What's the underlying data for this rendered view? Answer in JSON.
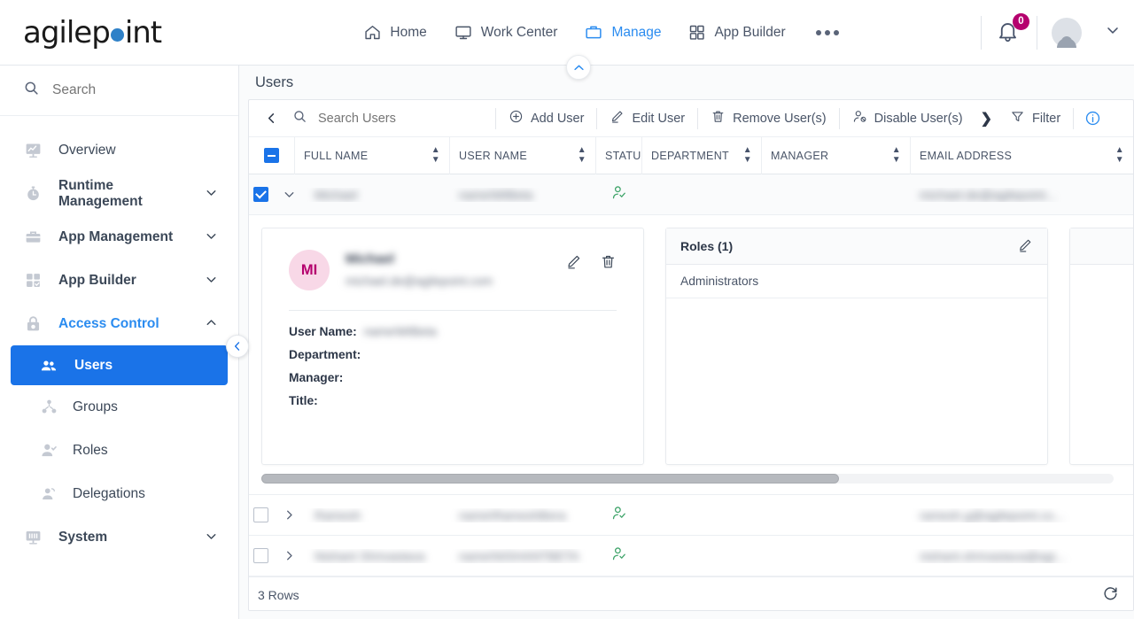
{
  "brand": {
    "name": "agilepoint",
    "accent": "#2f81c8"
  },
  "topnav": {
    "items": [
      {
        "label": "Home",
        "icon": "home-icon",
        "active": false
      },
      {
        "label": "Work Center",
        "icon": "monitor-icon",
        "active": false
      },
      {
        "label": "Manage",
        "icon": "briefcase-icon",
        "active": true
      },
      {
        "label": "App Builder",
        "icon": "grid-icon",
        "active": false
      }
    ],
    "more_label": "...",
    "notification_count": "0",
    "notification_badge_color": "#b5006e",
    "user_name": "",
    "active_color": "#2b8cf0"
  },
  "sidebar": {
    "search_placeholder": "Search",
    "search_value": "",
    "items": [
      {
        "label": "Overview",
        "icon": "chart-monitor-icon",
        "state": "plain"
      },
      {
        "label": "Runtime Management",
        "icon": "clock-icon",
        "state": "collapsed",
        "bold": true
      },
      {
        "label": "App Management",
        "icon": "toolbox-icon",
        "state": "collapsed",
        "bold": true
      },
      {
        "label": "App Builder",
        "icon": "grid-check-icon",
        "state": "collapsed",
        "bold": true
      },
      {
        "label": "Access Control",
        "icon": "lock-icon",
        "state": "expanded",
        "bold": true
      },
      {
        "label": "Users",
        "icon": "users-icon",
        "state": "selected",
        "sub": true
      },
      {
        "label": "Groups",
        "icon": "group-icon",
        "state": "plain",
        "sub": true
      },
      {
        "label": "Roles",
        "icon": "role-user-icon",
        "state": "plain",
        "sub": true
      },
      {
        "label": "Delegations",
        "icon": "delegation-user-icon",
        "state": "plain",
        "sub": true
      },
      {
        "label": "System",
        "icon": "system-monitor-icon",
        "state": "collapsed",
        "bold": true
      }
    ],
    "selected_color": "#1a73e8"
  },
  "page": {
    "title": "Users"
  },
  "toolbar": {
    "search_placeholder": "Search Users",
    "search_value": "",
    "buttons": [
      {
        "label": "Add User",
        "icon": "plus-circle-icon"
      },
      {
        "label": "Edit User",
        "icon": "pencil-icon"
      },
      {
        "label": "Remove User(s)",
        "icon": "trash-icon"
      },
      {
        "label": "Disable User(s)",
        "icon": "user-disable-icon"
      }
    ],
    "overflow_label": "❯",
    "filter_label": "Filter",
    "info_icon": "info-circle-icon"
  },
  "table": {
    "columns": [
      {
        "label": "FULL NAME",
        "sortable": true
      },
      {
        "label": "USER NAME",
        "sortable": true
      },
      {
        "label": "STATUS",
        "sortable": false
      },
      {
        "label": "DEPARTMENT",
        "sortable": true
      },
      {
        "label": "MANAGER",
        "sortable": true
      },
      {
        "label": "EMAIL ADDRESS",
        "sortable": true
      }
    ],
    "header_checkbox_state": "indeterminate",
    "rows": [
      {
        "checked": true,
        "expanded": true,
        "full_name": "Michael",
        "user_name": "name\\MIBeta",
        "status_icon": "user-check-icon",
        "department": "",
        "manager": "",
        "email": "michael.de@agilepoint..."
      },
      {
        "checked": false,
        "expanded": false,
        "full_name": "Ramesh",
        "user_name": "name\\RameshBera",
        "status_icon": "user-check-icon",
        "department": "",
        "manager": "",
        "email": "ramesh.g@agilepoint.co..."
      },
      {
        "checked": false,
        "expanded": false,
        "full_name": "Nishant Shrivastava",
        "user_name": "name\\NISHANTBETA",
        "status_icon": "user-check-icon",
        "department": "",
        "manager": "",
        "email": "nishant.shrivastava@agi..."
      }
    ],
    "footer_count": "3 Rows",
    "refresh_icon": "refresh-icon"
  },
  "detail": {
    "avatar_initials": "MI",
    "avatar_bg": "#f8d8e7",
    "avatar_fg": "#b5006e",
    "display_name": "Michael",
    "email": "michael.de@agilepoint.com",
    "edit_icon": "pencil-icon",
    "delete_icon": "trash-icon",
    "fields": [
      {
        "key": "User Name:",
        "value": "name\\MIBeta"
      },
      {
        "key": "Department:",
        "value": ""
      },
      {
        "key": "Manager:",
        "value": ""
      },
      {
        "key": "Title:",
        "value": ""
      }
    ],
    "roles_panel": {
      "title": "Roles (1)",
      "edit_icon": "pencil-icon",
      "items": [
        "Administrators"
      ]
    }
  }
}
